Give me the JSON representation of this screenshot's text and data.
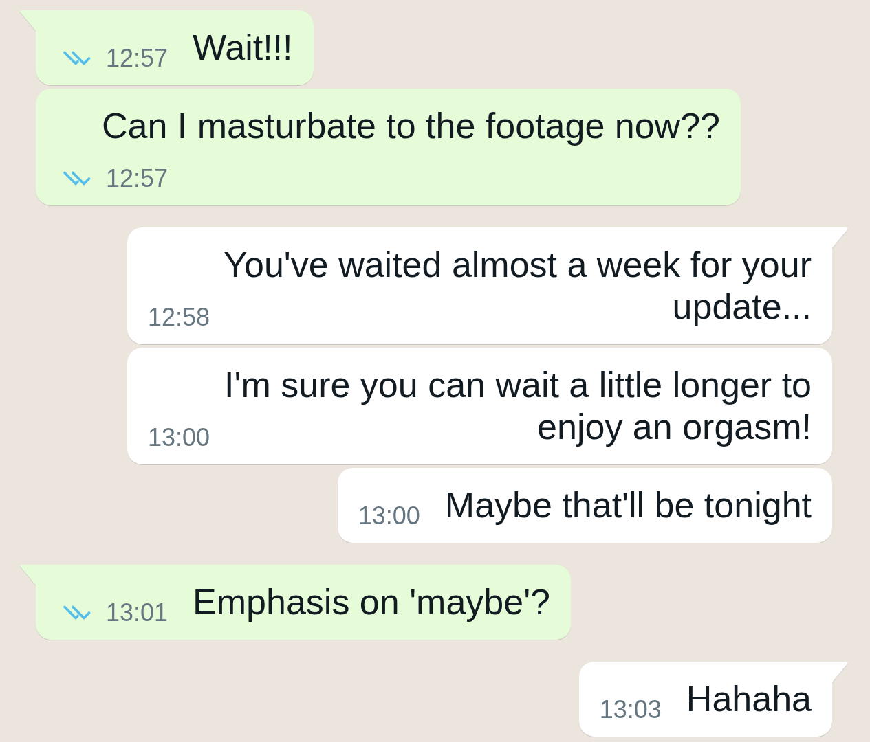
{
  "messages": [
    {
      "kind": "outgoing",
      "text": "Wait!!!",
      "time": "12:57",
      "read": true
    },
    {
      "kind": "outgoing",
      "text": "Can I masturbate to the footage now??",
      "time": "12:57",
      "read": true
    },
    {
      "kind": "incoming",
      "text": "You've waited almost a week for your update...",
      "time": "12:58"
    },
    {
      "kind": "incoming",
      "text": "I'm sure you can wait a little longer to enjoy an orgasm!",
      "time": "13:00"
    },
    {
      "kind": "incoming",
      "text": "Maybe that'll be tonight",
      "time": "13:00"
    },
    {
      "kind": "outgoing",
      "text": "Emphasis on 'maybe'?",
      "time": "13:01",
      "read": true
    },
    {
      "kind": "incoming",
      "text": "Hahaha",
      "time": "13:03"
    }
  ]
}
